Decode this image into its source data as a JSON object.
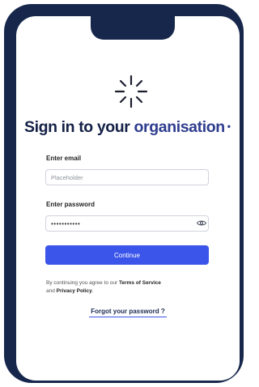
{
  "heading": {
    "prefix": "Sign in to your",
    "accent": "organisation",
    "dot": "•"
  },
  "email": {
    "label": "Enter email",
    "placeholder": "Placeholder",
    "value": ""
  },
  "password": {
    "label": "Enter password",
    "value": "•••••••••••",
    "toggle_icon": "eye-icon"
  },
  "continue_label": "Continue",
  "terms": {
    "prefix": "By continuing you agree to our",
    "terms_link": "Terms of Service",
    "and": "and",
    "privacy_link": "Privacy Policy",
    "suffix": "."
  },
  "forgot_label": "Forgot your password ?",
  "logo_icon": "starburst-logo-icon",
  "colors": {
    "frame": "#17274b",
    "heading": "#142146",
    "accent": "#2f3d8e",
    "button": "#3b55ea"
  }
}
